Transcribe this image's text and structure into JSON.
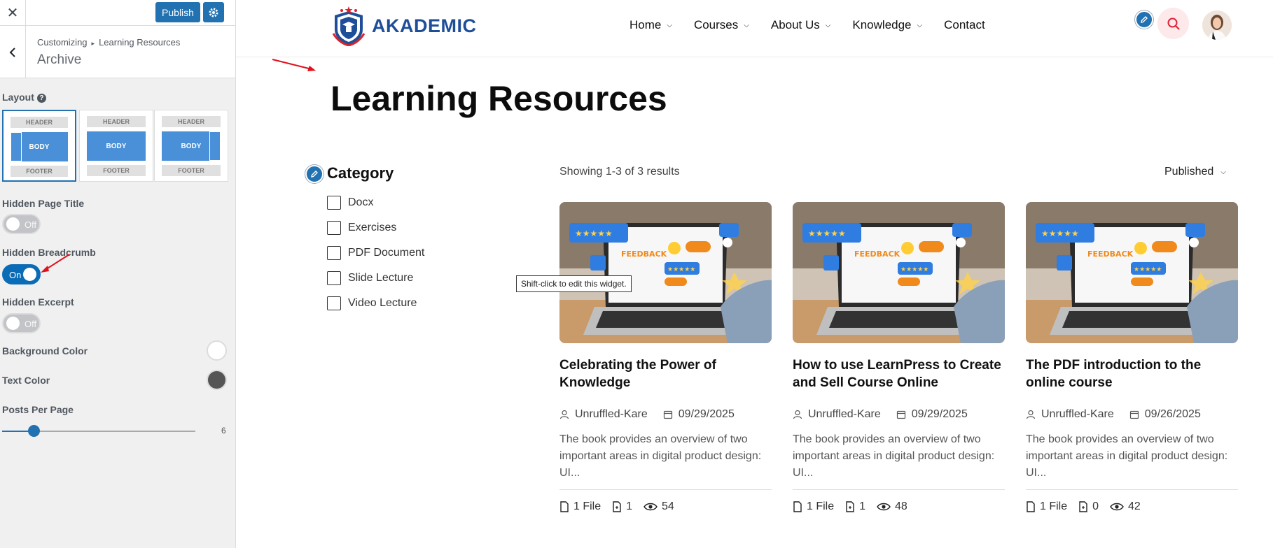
{
  "customizer": {
    "close_label": "✕",
    "publish_label": "Publish",
    "breadcrumb": {
      "root": "Customizing",
      "sep": "▸",
      "section": "Learning Resources"
    },
    "panel_title": "Archive",
    "layout": {
      "label": "Layout",
      "help": "?",
      "options": [
        {
          "header": "HEADER",
          "body": "BODY",
          "footer": "FOOTER"
        },
        {
          "header": "HEADER",
          "body": "BODY",
          "footer": "FOOTER"
        },
        {
          "header": "HEADER",
          "body": "BODY",
          "footer": "FOOTER"
        }
      ]
    },
    "hidden_page_title": {
      "label": "Hidden Page Title",
      "state": "Off"
    },
    "hidden_breadcrumb": {
      "label": "Hidden Breadcrumb",
      "state": "On"
    },
    "hidden_excerpt": {
      "label": "Hidden Excerpt",
      "state": "Off"
    },
    "background_color": {
      "label": "Background Color",
      "value": "#ffffff"
    },
    "text_color": {
      "label": "Text Color",
      "value": "#555555"
    },
    "posts_per_page": {
      "label": "Posts Per Page",
      "value": "6"
    },
    "accent": "#2271b1"
  },
  "site": {
    "logo_text": "AKADEMIC",
    "nav": [
      "Home",
      "Courses",
      "About Us",
      "Knowledge",
      "Contact"
    ],
    "nav_has_dropdown": [
      true,
      true,
      true,
      true,
      false
    ],
    "page_title": "Learning Resources",
    "category": {
      "title": "Category",
      "items": [
        "Docx",
        "Exercises",
        "PDF Document",
        "Slide Lecture",
        "Video Lecture"
      ]
    },
    "results_text": "Showing 1-3 of 3 results",
    "sort_label": "Published",
    "tooltip": "Shift-click to edit this widget.",
    "cards": [
      {
        "title": "Celebrating the Power of Knowledge",
        "author": "Unruffled-Kare",
        "date": "09/29/2025",
        "excerpt": "The book provides an overview of two important areas in digital product design: UI...",
        "files": "1 File",
        "docs": "1",
        "views": "54"
      },
      {
        "title": "How to use LearnPress to Create and Sell Course Online",
        "author": "Unruffled-Kare",
        "date": "09/29/2025",
        "excerpt": "The book provides an overview of two important areas in digital product design: UI...",
        "files": "1 File",
        "docs": "1",
        "views": "48"
      },
      {
        "title": "The PDF introduction to the online course",
        "author": "Unruffled-Kare",
        "date": "09/26/2025",
        "excerpt": "The book provides an overview of two important areas in digital product design: UI...",
        "files": "1 File",
        "docs": "0",
        "views": "42"
      }
    ],
    "brand_color": "#1f4e99",
    "search_accent": "#e0243a"
  }
}
